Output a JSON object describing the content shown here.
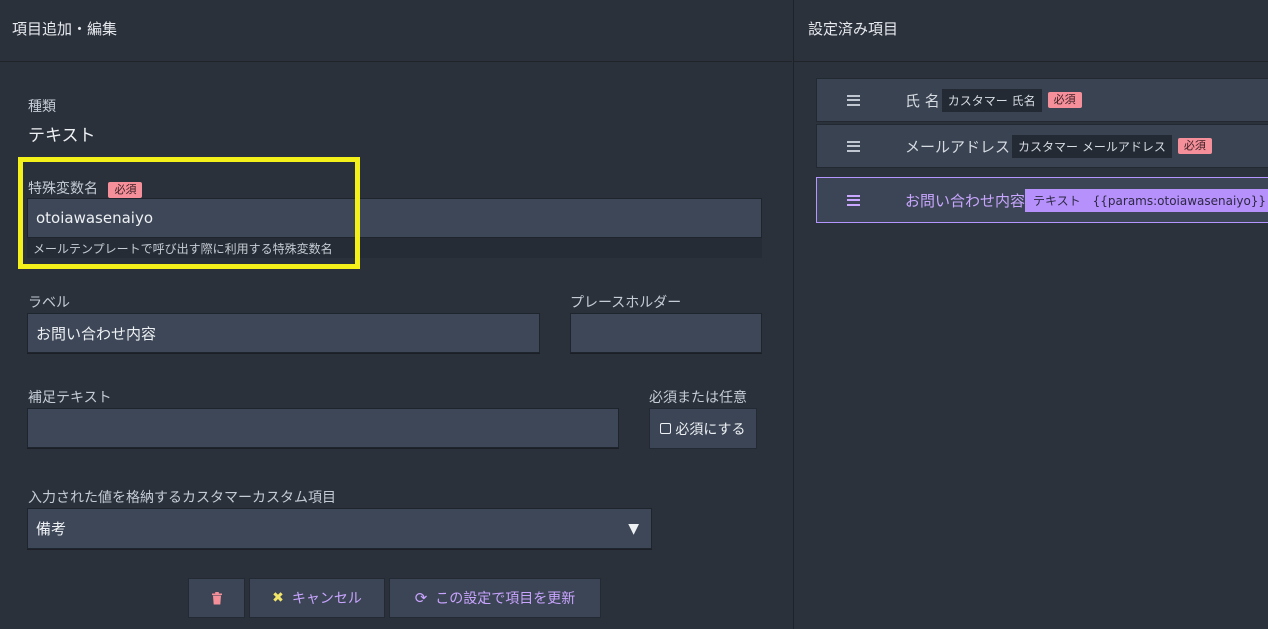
{
  "left_panel": {
    "title": "項目追加・編集",
    "type_label": "種類",
    "type_value": "テキスト",
    "variable": {
      "label": "特殊変数名",
      "required_badge": "必須",
      "value": "otoiawasenaiyo",
      "hint": "メールテンプレートで呼び出す際に利用する特殊変数名"
    },
    "label_field": {
      "label": "ラベル",
      "value": "お問い合わせ内容"
    },
    "placeholder_field": {
      "label": "プレースホルダー",
      "value": ""
    },
    "supplement_field": {
      "label": "補足テキスト",
      "value": ""
    },
    "required_toggle": {
      "label": "必須または任意",
      "button_label": "必須にする"
    },
    "custom_field": {
      "label": "入力された値を格納するカスタマーカスタム項目",
      "value": "備考"
    },
    "buttons": {
      "delete_icon": "trash-icon",
      "cancel_label": "キャンセル",
      "update_label": "この設定で項目を更新"
    }
  },
  "right_panel": {
    "title": "設定済み項目",
    "items": [
      {
        "name": "氏 名",
        "tag": "カスタマー 氏名",
        "required_badge": "必須"
      },
      {
        "name": "メールアドレス",
        "tag": "カスタマー メールアドレス",
        "required_badge": "必須"
      },
      {
        "name": "お問い合わせ内容",
        "tag": "テキスト　{{params:otoiawasenaiyo}}",
        "required_badge": ""
      }
    ]
  },
  "colors": {
    "accent": "#b691fb",
    "required": "#f58f9a",
    "highlight": "#f4f01a"
  }
}
